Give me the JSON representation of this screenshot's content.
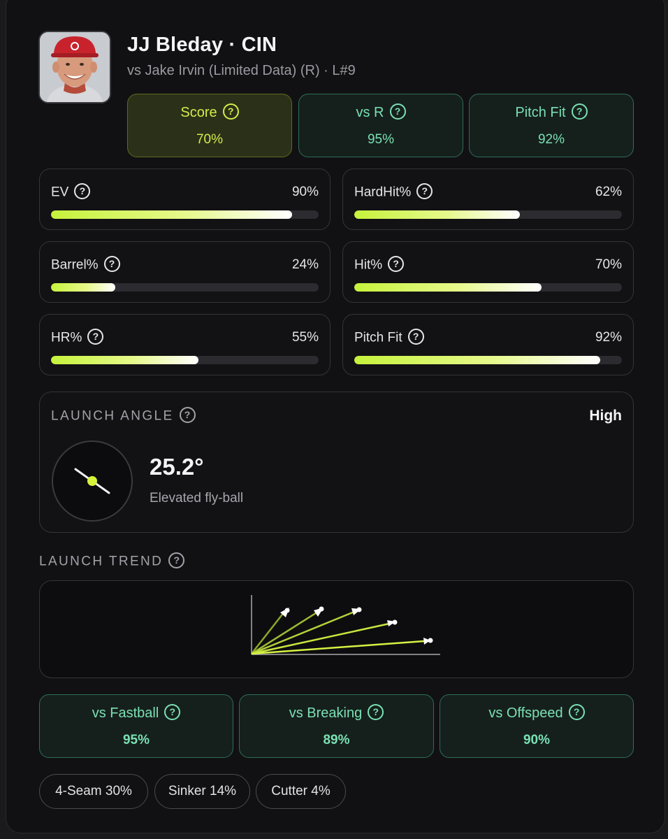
{
  "player": {
    "name": "JJ Bleday · CIN",
    "subtitle": "vs Jake Irvin (Limited Data) (R) · L#9"
  },
  "summary": [
    {
      "label": "Score",
      "value": "70%"
    },
    {
      "label": "vs R",
      "value": "95%"
    },
    {
      "label": "Pitch Fit",
      "value": "92%"
    }
  ],
  "stats": [
    {
      "label": "EV",
      "value": "90%",
      "fill": 0.9
    },
    {
      "label": "HardHit%",
      "value": "62%",
      "fill": 0.62
    },
    {
      "label": "Barrel%",
      "value": "24%",
      "fill": 0.24
    },
    {
      "label": "Hit%",
      "value": "70%",
      "fill": 0.7
    },
    {
      "label": "HR%",
      "value": "55%",
      "fill": 0.55
    },
    {
      "label": "Pitch Fit",
      "value": "92%",
      "fill": 0.92
    }
  ],
  "launch_angle": {
    "title": "LAUNCH ANGLE",
    "rating": "High",
    "value": "25.2°",
    "description": "Elevated fly-ball"
  },
  "launch_trend": {
    "title": "LAUNCH TREND"
  },
  "vs_pitch": [
    {
      "label": "vs Fastball",
      "value": "95%"
    },
    {
      "label": "vs Breaking",
      "value": "89%"
    },
    {
      "label": "vs Offspeed",
      "value": "90%"
    }
  ],
  "pitch_mix": [
    {
      "label": "4-Seam 30%"
    },
    {
      "label": "Sinker 14%"
    },
    {
      "label": "Cutter 4%"
    }
  ],
  "colors": {
    "accent_lime": "#c6f23c",
    "accent_green": "#7be0b3",
    "score_text": "#d6ec4a"
  }
}
